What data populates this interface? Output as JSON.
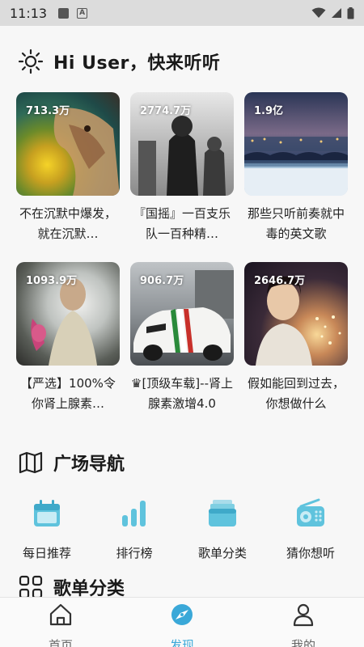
{
  "status_bar": {
    "time": "11:13"
  },
  "greeting": {
    "title": "Hi User，快来听听"
  },
  "playlists": [
    {
      "plays": "713.3万",
      "name": "不在沉默中爆发，就在沉默…"
    },
    {
      "plays": "2774.7万",
      "name": "『国摇』一百支乐队一百种精…"
    },
    {
      "plays": "1.9亿",
      "name": "那些只听前奏就中毒的英文歌"
    },
    {
      "plays": "1093.9万",
      "name": "【严选】100%令你肾上腺素…"
    },
    {
      "plays": "906.7万",
      "name": "♛[顶级车载]--肾上腺素激增4.0"
    },
    {
      "plays": "2646.7万",
      "name": "假如能回到过去，你想做什么"
    }
  ],
  "square_nav": {
    "title": "广场导航",
    "items": [
      {
        "label": "每日推荐",
        "icon": "calendar-icon"
      },
      {
        "label": "排行榜",
        "icon": "bar-chart-icon"
      },
      {
        "label": "歌单分类",
        "icon": "stack-icon"
      },
      {
        "label": "猜你想听",
        "icon": "radio-icon"
      }
    ]
  },
  "category_section": {
    "title": "歌单分类"
  },
  "bottom_tabs": [
    {
      "label": "首页",
      "icon": "home-icon"
    },
    {
      "label": "发现",
      "icon": "discover-icon"
    },
    {
      "label": "我的",
      "icon": "user-icon"
    }
  ],
  "colors": {
    "accent": "#3aa8d8",
    "icon_teal": "#5fc3dd"
  }
}
